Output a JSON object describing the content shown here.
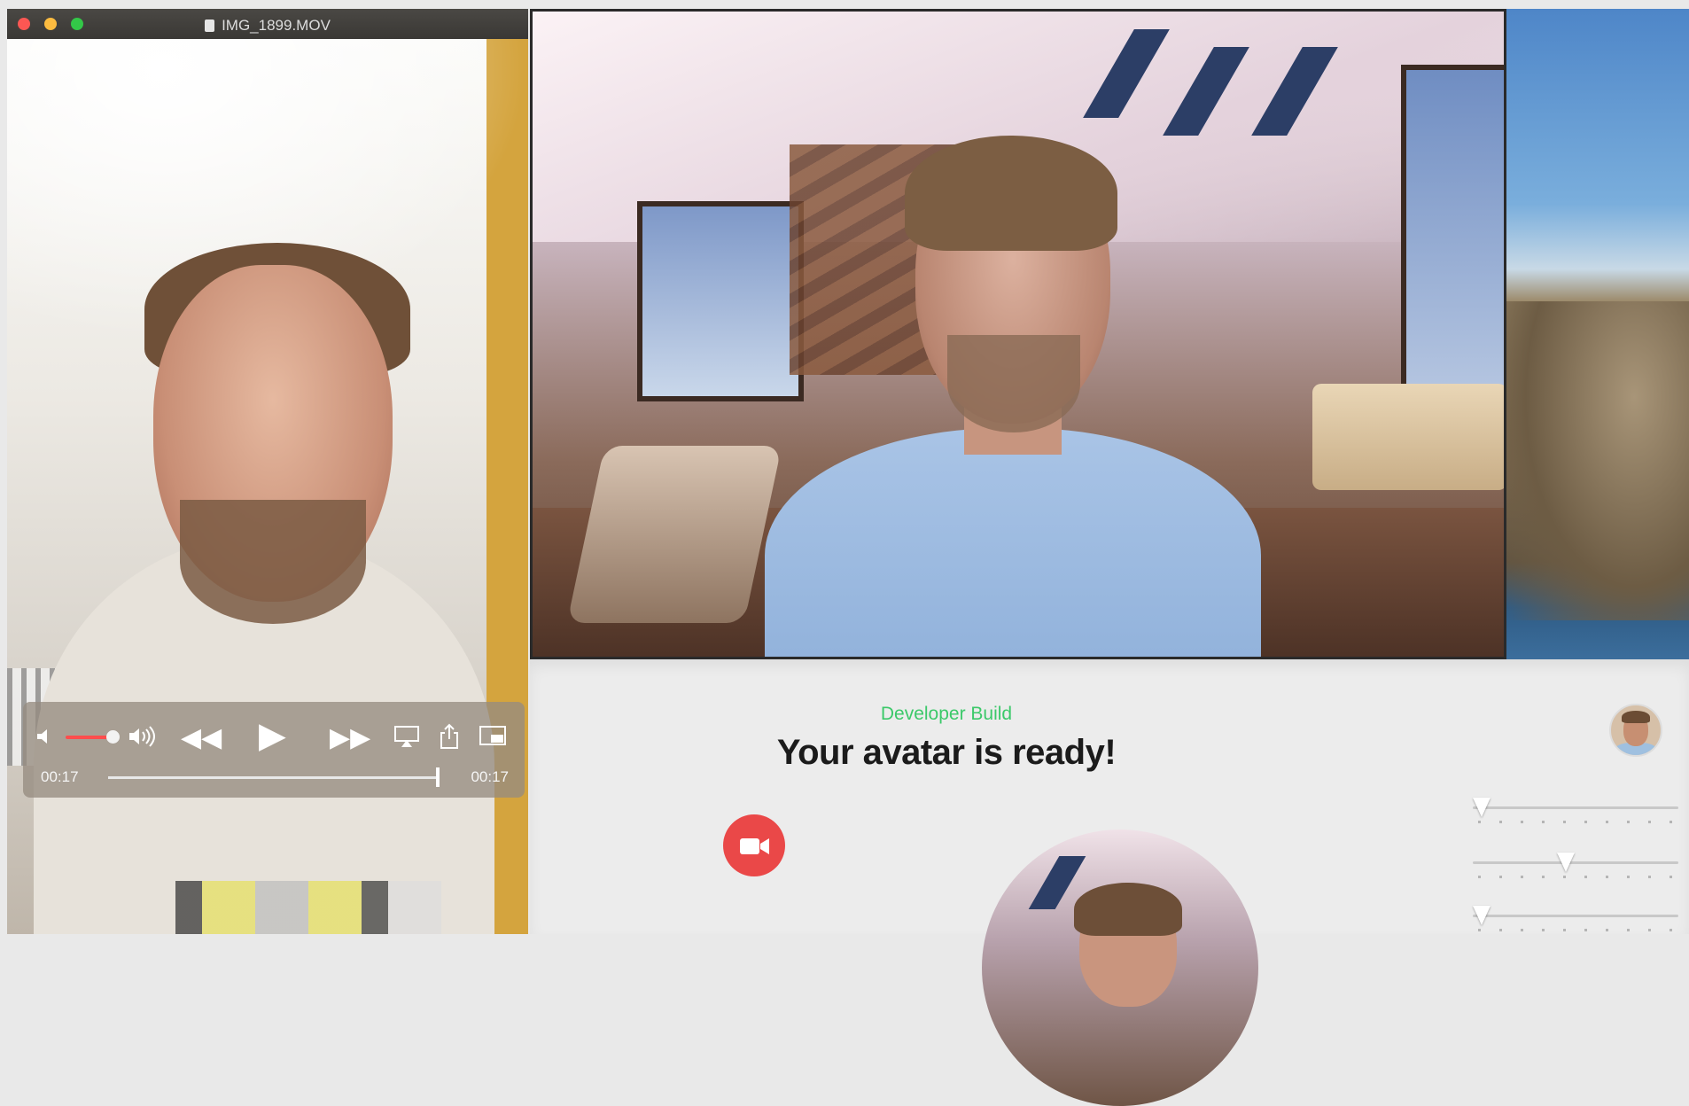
{
  "quicktime": {
    "title": "IMG_1899.MOV",
    "controls": {
      "volume_fraction": 0.8,
      "time_current": "00:17",
      "time_total": "00:17",
      "progress_fraction": 1.0
    },
    "icons": {
      "volume_low": "speaker-low-icon",
      "volume_high": "speaker-high-icon",
      "rewind": "rewind-icon",
      "play": "play-icon",
      "fast_forward": "fast-forward-icon",
      "airplay": "airplay-icon",
      "share": "share-icon",
      "picture_in_picture": "picture-in-picture-icon"
    }
  },
  "app": {
    "build_label": "Developer Build",
    "headline": "Your avatar is ready!",
    "record_icon": "video-camera-icon",
    "sliders": [
      {
        "name": "slider-1",
        "value_fraction": 0.0
      },
      {
        "name": "slider-2",
        "value_fraction": 0.45
      },
      {
        "name": "slider-3",
        "value_fraction": 0.0
      }
    ]
  },
  "colors": {
    "build_label": "#3cc96a",
    "record_button": "#ea4848",
    "volume_fill": "#ff4d4d",
    "traffic_red": "#fc5753",
    "traffic_yellow": "#fdbc40",
    "traffic_green": "#33c748"
  }
}
